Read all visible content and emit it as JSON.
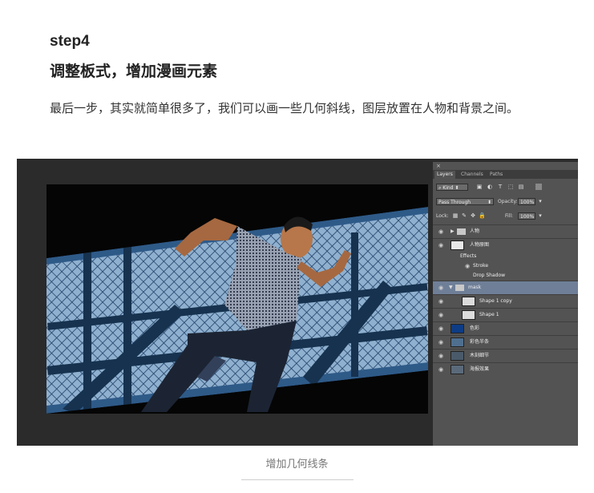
{
  "article": {
    "step": "step4",
    "heading": "调整板式，增加漫画元素",
    "paragraph": "最后一步，其实就简单很多了，我们可以画一些几何斜线，图层放置在人物和背景之间。",
    "caption": "增加几何线条"
  },
  "panel": {
    "close": "×",
    "tabs": [
      "Layers",
      "Channels",
      "Paths"
    ],
    "filter_kind": "Kind",
    "blend_mode": "Pass Through",
    "opacity_label": "Opacity:",
    "opacity_value": "100%",
    "lock_label": "Lock:",
    "fill_label": "Fill:",
    "fill_value": "100%",
    "layers": [
      {
        "name": "人物",
        "type": "group"
      },
      {
        "name": "人物原图",
        "type": "smart"
      },
      {
        "name": "Effects",
        "type": "effects"
      },
      {
        "name": "Stroke",
        "type": "effect"
      },
      {
        "name": "Drop Shadow",
        "type": "effect"
      },
      {
        "name": "mask",
        "type": "group-selected"
      },
      {
        "name": "Shape 1 copy",
        "type": "shape"
      },
      {
        "name": "Shape 1",
        "type": "shape"
      },
      {
        "name": "色彩",
        "type": "fill"
      },
      {
        "name": "彩色半条",
        "type": "image"
      },
      {
        "name": "木刻细节",
        "type": "image"
      },
      {
        "name": "海报效果",
        "type": "image"
      }
    ]
  },
  "colors": {
    "canvas_bg": "#050505",
    "mesh_blue": "#1f4d7a",
    "sky": "#8fb0cf",
    "color_fill_thumb": "#0e3c85",
    "selected_row": "#6f7f98"
  }
}
